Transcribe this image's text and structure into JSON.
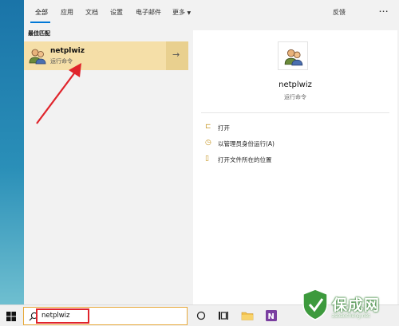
{
  "tabs": [
    {
      "label": "全部",
      "active": true
    },
    {
      "label": "应用"
    },
    {
      "label": "文档"
    },
    {
      "label": "设置"
    },
    {
      "label": "电子邮件"
    },
    {
      "label": "更多"
    }
  ],
  "topbar": {
    "feedback_label": "反馈",
    "more_options": "···"
  },
  "section": {
    "best_match_label": "最佳匹配"
  },
  "best_match": {
    "title": "netplwiz",
    "subtitle": "运行命令",
    "icon": "users-icon"
  },
  "detail": {
    "title": "netplwiz",
    "subtitle": "运行命令",
    "actions": [
      {
        "label": "打开",
        "icon": "open-icon"
      },
      {
        "label": "以管理员身份运行(A)",
        "icon": "shield-icon"
      },
      {
        "label": "打开文件所在的位置",
        "icon": "folder-icon"
      }
    ]
  },
  "taskbar": {
    "search_value": "netplwiz"
  },
  "watermark": {
    "brand": "保成网",
    "url": "zsbaocheng.net"
  },
  "colors": {
    "highlight": "#f5dfa8",
    "accent": "#0078d7",
    "annotation": "#e0242b"
  }
}
